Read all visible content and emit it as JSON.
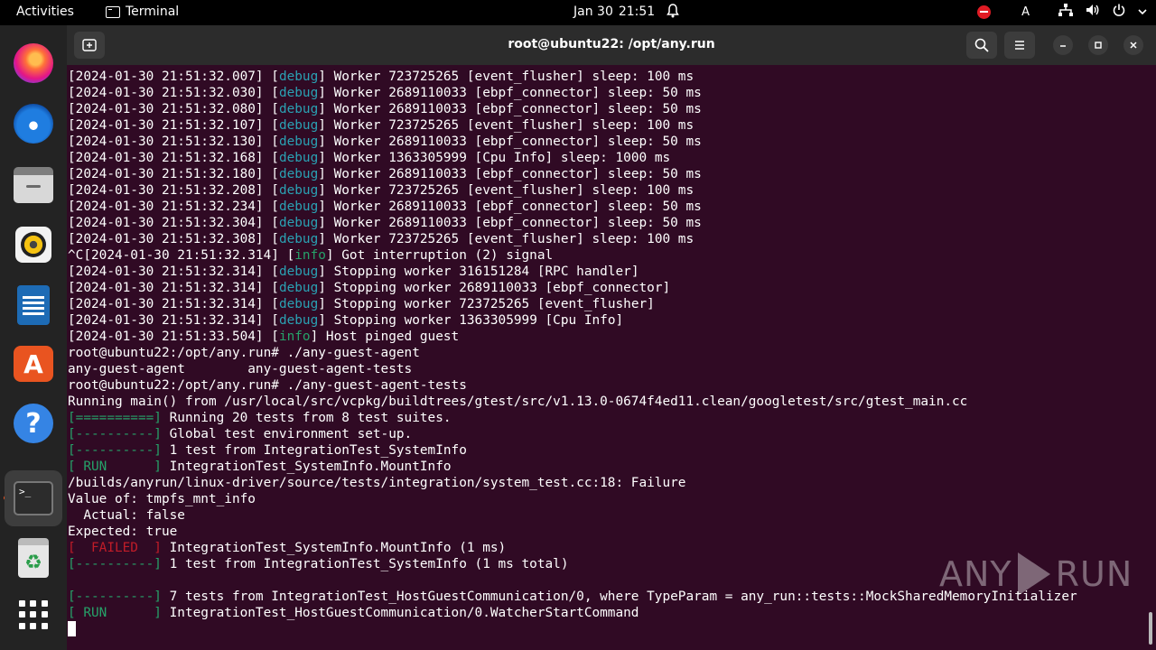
{
  "topbar": {
    "activities": "Activities",
    "app_name": "Terminal",
    "date": "Jan 30",
    "time": "21:51",
    "keyboard": "A"
  },
  "window": {
    "title": "root@ubuntu22: /opt/any.run"
  },
  "dock": {
    "items": [
      "firefox-icon",
      "thunderbird-icon",
      "files-icon",
      "rhythmbox-icon",
      "writer-icon",
      "app-center-icon",
      "help-icon",
      "terminal-icon",
      "trash-icon",
      "show-apps-icon"
    ],
    "trash_glyph": "♻",
    "store_glyph": "A",
    "help_glyph": "?",
    "term_glyph": ">_"
  },
  "terminal": {
    "lines": [
      [
        {
          "t": "[2024-01-30 21:51:32.007] ["
        },
        {
          "t": "debug",
          "c": "debug"
        },
        {
          "t": "] Worker 723725265 [event_flusher] sleep: 100 ms"
        }
      ],
      [
        {
          "t": "[2024-01-30 21:51:32.030] ["
        },
        {
          "t": "debug",
          "c": "debug"
        },
        {
          "t": "] Worker 2689110033 [ebpf_connector] sleep: 50 ms"
        }
      ],
      [
        {
          "t": "[2024-01-30 21:51:32.080] ["
        },
        {
          "t": "debug",
          "c": "debug"
        },
        {
          "t": "] Worker 2689110033 [ebpf_connector] sleep: 50 ms"
        }
      ],
      [
        {
          "t": "[2024-01-30 21:51:32.107] ["
        },
        {
          "t": "debug",
          "c": "debug"
        },
        {
          "t": "] Worker 723725265 [event_flusher] sleep: 100 ms"
        }
      ],
      [
        {
          "t": "[2024-01-30 21:51:32.130] ["
        },
        {
          "t": "debug",
          "c": "debug"
        },
        {
          "t": "] Worker 2689110033 [ebpf_connector] sleep: 50 ms"
        }
      ],
      [
        {
          "t": "[2024-01-30 21:51:32.168] ["
        },
        {
          "t": "debug",
          "c": "debug"
        },
        {
          "t": "] Worker 1363305999 [Cpu Info] sleep: 1000 ms"
        }
      ],
      [
        {
          "t": "[2024-01-30 21:51:32.180] ["
        },
        {
          "t": "debug",
          "c": "debug"
        },
        {
          "t": "] Worker 2689110033 [ebpf_connector] sleep: 50 ms"
        }
      ],
      [
        {
          "t": "[2024-01-30 21:51:32.208] ["
        },
        {
          "t": "debug",
          "c": "debug"
        },
        {
          "t": "] Worker 723725265 [event_flusher] sleep: 100 ms"
        }
      ],
      [
        {
          "t": "[2024-01-30 21:51:32.234] ["
        },
        {
          "t": "debug",
          "c": "debug"
        },
        {
          "t": "] Worker 2689110033 [ebpf_connector] sleep: 50 ms"
        }
      ],
      [
        {
          "t": "[2024-01-30 21:51:32.304] ["
        },
        {
          "t": "debug",
          "c": "debug"
        },
        {
          "t": "] Worker 2689110033 [ebpf_connector] sleep: 50 ms"
        }
      ],
      [
        {
          "t": "[2024-01-30 21:51:32.308] ["
        },
        {
          "t": "debug",
          "c": "debug"
        },
        {
          "t": "] Worker 723725265 [event_flusher] sleep: 100 ms"
        }
      ],
      [
        {
          "t": "^C[2024-01-30 21:51:32.314] ["
        },
        {
          "t": "info",
          "c": "info"
        },
        {
          "t": "] Got interruption (2) signal"
        }
      ],
      [
        {
          "t": "[2024-01-30 21:51:32.314] ["
        },
        {
          "t": "debug",
          "c": "debug"
        },
        {
          "t": "] Stopping worker 316151284 [RPC handler]"
        }
      ],
      [
        {
          "t": "[2024-01-30 21:51:32.314] ["
        },
        {
          "t": "debug",
          "c": "debug"
        },
        {
          "t": "] Stopping worker 2689110033 [ebpf_connector]"
        }
      ],
      [
        {
          "t": "[2024-01-30 21:51:32.314] ["
        },
        {
          "t": "debug",
          "c": "debug"
        },
        {
          "t": "] Stopping worker 723725265 [event_flusher]"
        }
      ],
      [
        {
          "t": "[2024-01-30 21:51:32.314] ["
        },
        {
          "t": "debug",
          "c": "debug"
        },
        {
          "t": "] Stopping worker 1363305999 [Cpu Info]"
        }
      ],
      [
        {
          "t": "[2024-01-30 21:51:33.504] ["
        },
        {
          "t": "info",
          "c": "info"
        },
        {
          "t": "] Host pinged guest"
        }
      ],
      [
        {
          "t": "root@ubuntu22:/opt/any.run# ./any-guest-agent"
        }
      ],
      [
        {
          "t": "any-guest-agent        any-guest-agent-tests"
        }
      ],
      [
        {
          "t": "root@ubuntu22:/opt/any.run# ./any-guest-agent-tests"
        }
      ],
      [
        {
          "t": "Running main() from /usr/local/src/vcpkg/buildtrees/gtest/src/v1.13.0-0674f4ed11.clean/googletest/src/gtest_main.cc"
        }
      ],
      [
        {
          "t": "[==========]",
          "c": "green"
        },
        {
          "t": " Running 20 tests from 8 test suites."
        }
      ],
      [
        {
          "t": "[----------]",
          "c": "green"
        },
        {
          "t": " Global test environment set-up."
        }
      ],
      [
        {
          "t": "[----------]",
          "c": "green"
        },
        {
          "t": " 1 test from IntegrationTest_SystemInfo"
        }
      ],
      [
        {
          "t": "[ RUN      ]",
          "c": "green"
        },
        {
          "t": " IntegrationTest_SystemInfo.MountInfo"
        }
      ],
      [
        {
          "t": "/builds/anyrun/linux-driver/source/tests/integration/system_test.cc:18: Failure"
        }
      ],
      [
        {
          "t": "Value of: tmpfs_mnt_info"
        }
      ],
      [
        {
          "t": "  Actual: false"
        }
      ],
      [
        {
          "t": "Expected: true"
        }
      ],
      [
        {
          "t": "[  FAILED  ]",
          "c": "red"
        },
        {
          "t": " IntegrationTest_SystemInfo.MountInfo (1 ms)"
        }
      ],
      [
        {
          "t": "[----------]",
          "c": "green"
        },
        {
          "t": " 1 test from IntegrationTest_SystemInfo (1 ms total)"
        }
      ],
      [
        {
          "t": ""
        }
      ],
      [
        {
          "t": "[----------]",
          "c": "green"
        },
        {
          "t": " 7 tests from IntegrationTest_HostGuestCommunication/0, where TypeParam = any_run::tests::MockSharedMemoryInitializer"
        }
      ],
      [
        {
          "t": "[ RUN      ]",
          "c": "green"
        },
        {
          "t": " IntegrationTest_HostGuestCommunication/0.WatcherStartCommand"
        }
      ]
    ]
  },
  "watermark": {
    "left": "ANY",
    "right": "RUN"
  }
}
